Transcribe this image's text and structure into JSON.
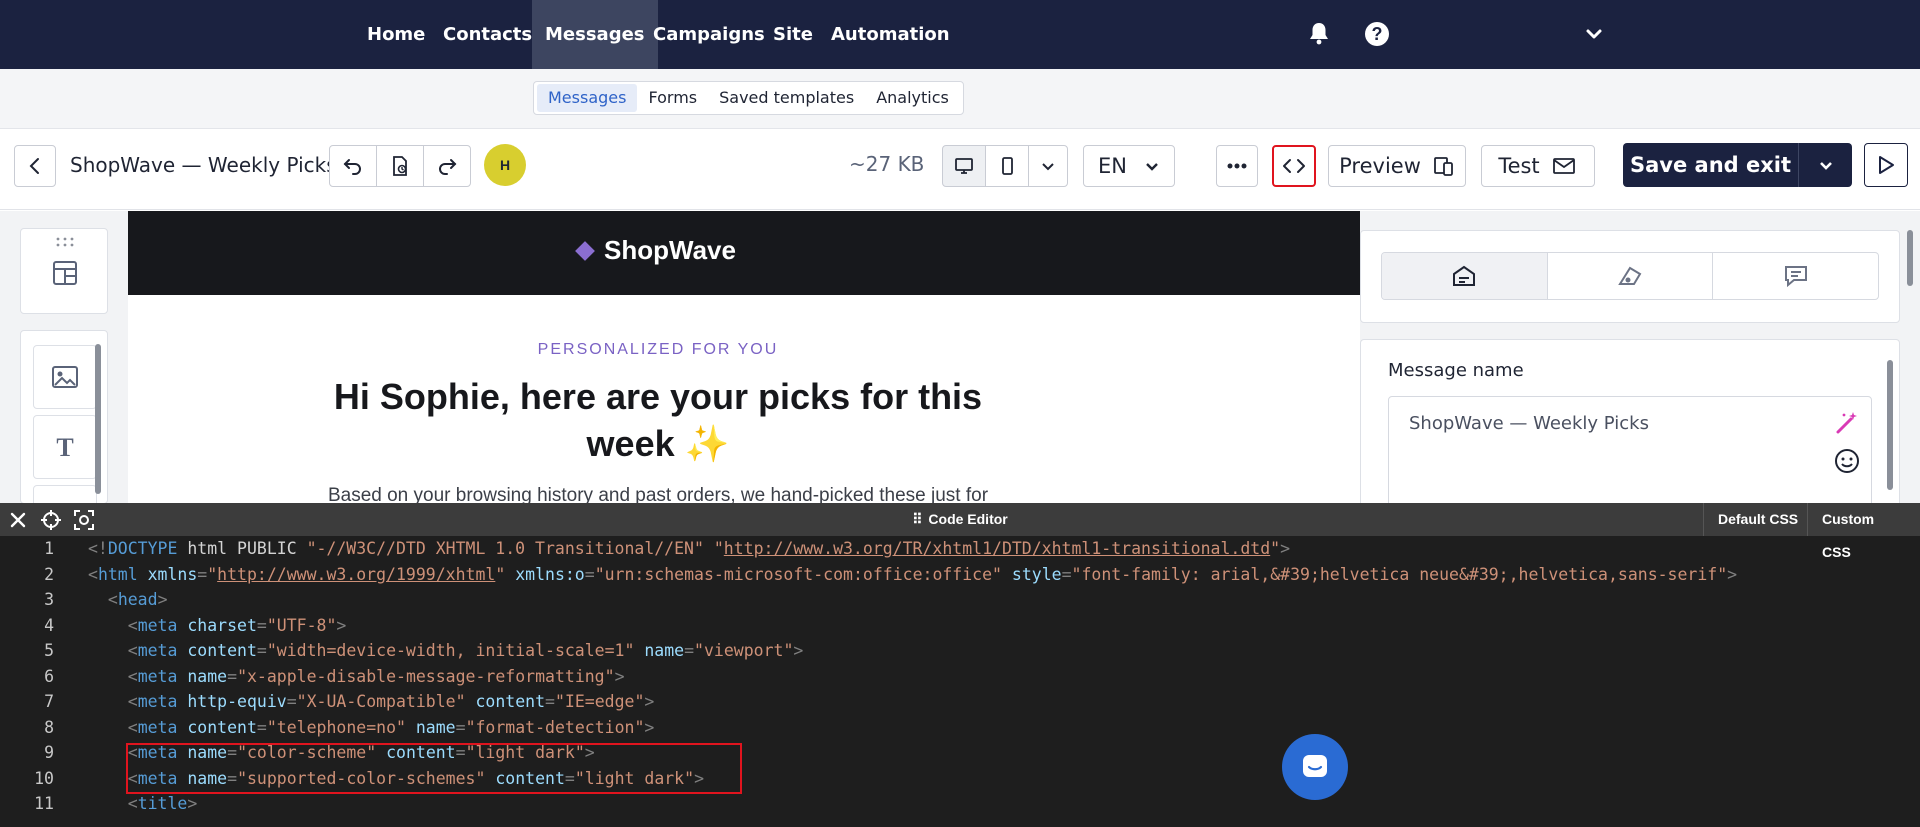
{
  "topnav": {
    "items": [
      {
        "label": "Home"
      },
      {
        "label": "Contacts"
      },
      {
        "label": "Messages"
      },
      {
        "label": "Campaigns"
      },
      {
        "label": "Site"
      },
      {
        "label": "Automation"
      }
    ],
    "active": "Messages",
    "icons": [
      "bell-icon",
      "help-icon",
      "chevron-down-icon"
    ]
  },
  "subnav": {
    "items": [
      {
        "label": "Messages"
      },
      {
        "label": "Forms"
      },
      {
        "label": "Saved templates"
      },
      {
        "label": "Analytics"
      }
    ],
    "active": "Messages"
  },
  "toolbar": {
    "title": "ShopWave — Weekly Picks",
    "avatar": "H",
    "size": "~27 KB",
    "language": "EN",
    "preview_label": "Preview",
    "test_label": "Test",
    "save_label": "Save and exit"
  },
  "email": {
    "brand": "ShopWave",
    "eyebrow": "PERSONALIZED FOR YOU",
    "title": "Hi Sophie, here are your picks for this week ✨",
    "body": "Based on your browsing history and past orders, we hand-picked these just for"
  },
  "props": {
    "name_label": "Message name",
    "name_value": "ShopWave — Weekly Picks"
  },
  "code_editor": {
    "title": "Code Editor",
    "default_css": "Default CSS",
    "custom_css": "Custom CSS",
    "lines": [
      {
        "n": "1",
        "text": "<!DOCTYPE html PUBLIC \"-//W3C//DTD XHTML 1.0 Transitional//EN\" \"http://www.w3.org/TR/xhtml1/DTD/xhtml1-transitional.dtd\">"
      },
      {
        "n": "2",
        "text": "<html xmlns=\"http://www.w3.org/1999/xhtml\" xmlns:o=\"urn:schemas-microsoft-com:office:office\" style=\"font-family: arial,&#39;helvetica neue&#39;,helvetica,sans-serif\">"
      },
      {
        "n": "3",
        "text": "  <head>"
      },
      {
        "n": "4",
        "text": "    <meta charset=\"UTF-8\">"
      },
      {
        "n": "5",
        "text": "    <meta content=\"width=device-width, initial-scale=1\" name=\"viewport\">"
      },
      {
        "n": "6",
        "text": "    <meta name=\"x-apple-disable-message-reformatting\">"
      },
      {
        "n": "7",
        "text": "    <meta http-equiv=\"X-UA-Compatible\" content=\"IE=edge\">"
      },
      {
        "n": "8",
        "text": "    <meta content=\"telephone=no\" name=\"format-detection\">"
      },
      {
        "n": "9",
        "text": "    <meta name=\"color-scheme\" content=\"light dark\">"
      },
      {
        "n": "10",
        "text": "    <meta name=\"supported-color-schemes\" content=\"light dark\">"
      },
      {
        "n": "11",
        "text": "    <title>"
      }
    ]
  },
  "colors": {
    "nav_bg": "#1b2240",
    "accent_blue": "#2f63c8",
    "highlight_red": "#e0141e",
    "brand_purple": "#8b6ed1",
    "avatar_yellow": "#d8ce2f"
  }
}
